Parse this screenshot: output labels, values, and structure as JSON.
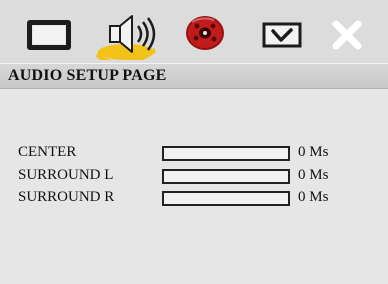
{
  "header": {
    "icons": [
      {
        "name": "tv-screen-icon",
        "active": false
      },
      {
        "name": "audio-speaker-icon",
        "active": true
      },
      {
        "name": "disc-icon",
        "active": false
      },
      {
        "name": "checkbox-icon",
        "active": false
      },
      {
        "name": "close-icon",
        "active": false
      }
    ],
    "highlight_color": "#f2c21b"
  },
  "page": {
    "title": "AUDIO SETUP PAGE"
  },
  "settings": [
    {
      "label": "CENTER",
      "value": "0 Ms",
      "level": 0
    },
    {
      "label": "SURROUND L",
      "value": "0 Ms",
      "level": 0
    },
    {
      "label": "SURROUND R",
      "value": "0 Ms",
      "level": 0
    }
  ]
}
